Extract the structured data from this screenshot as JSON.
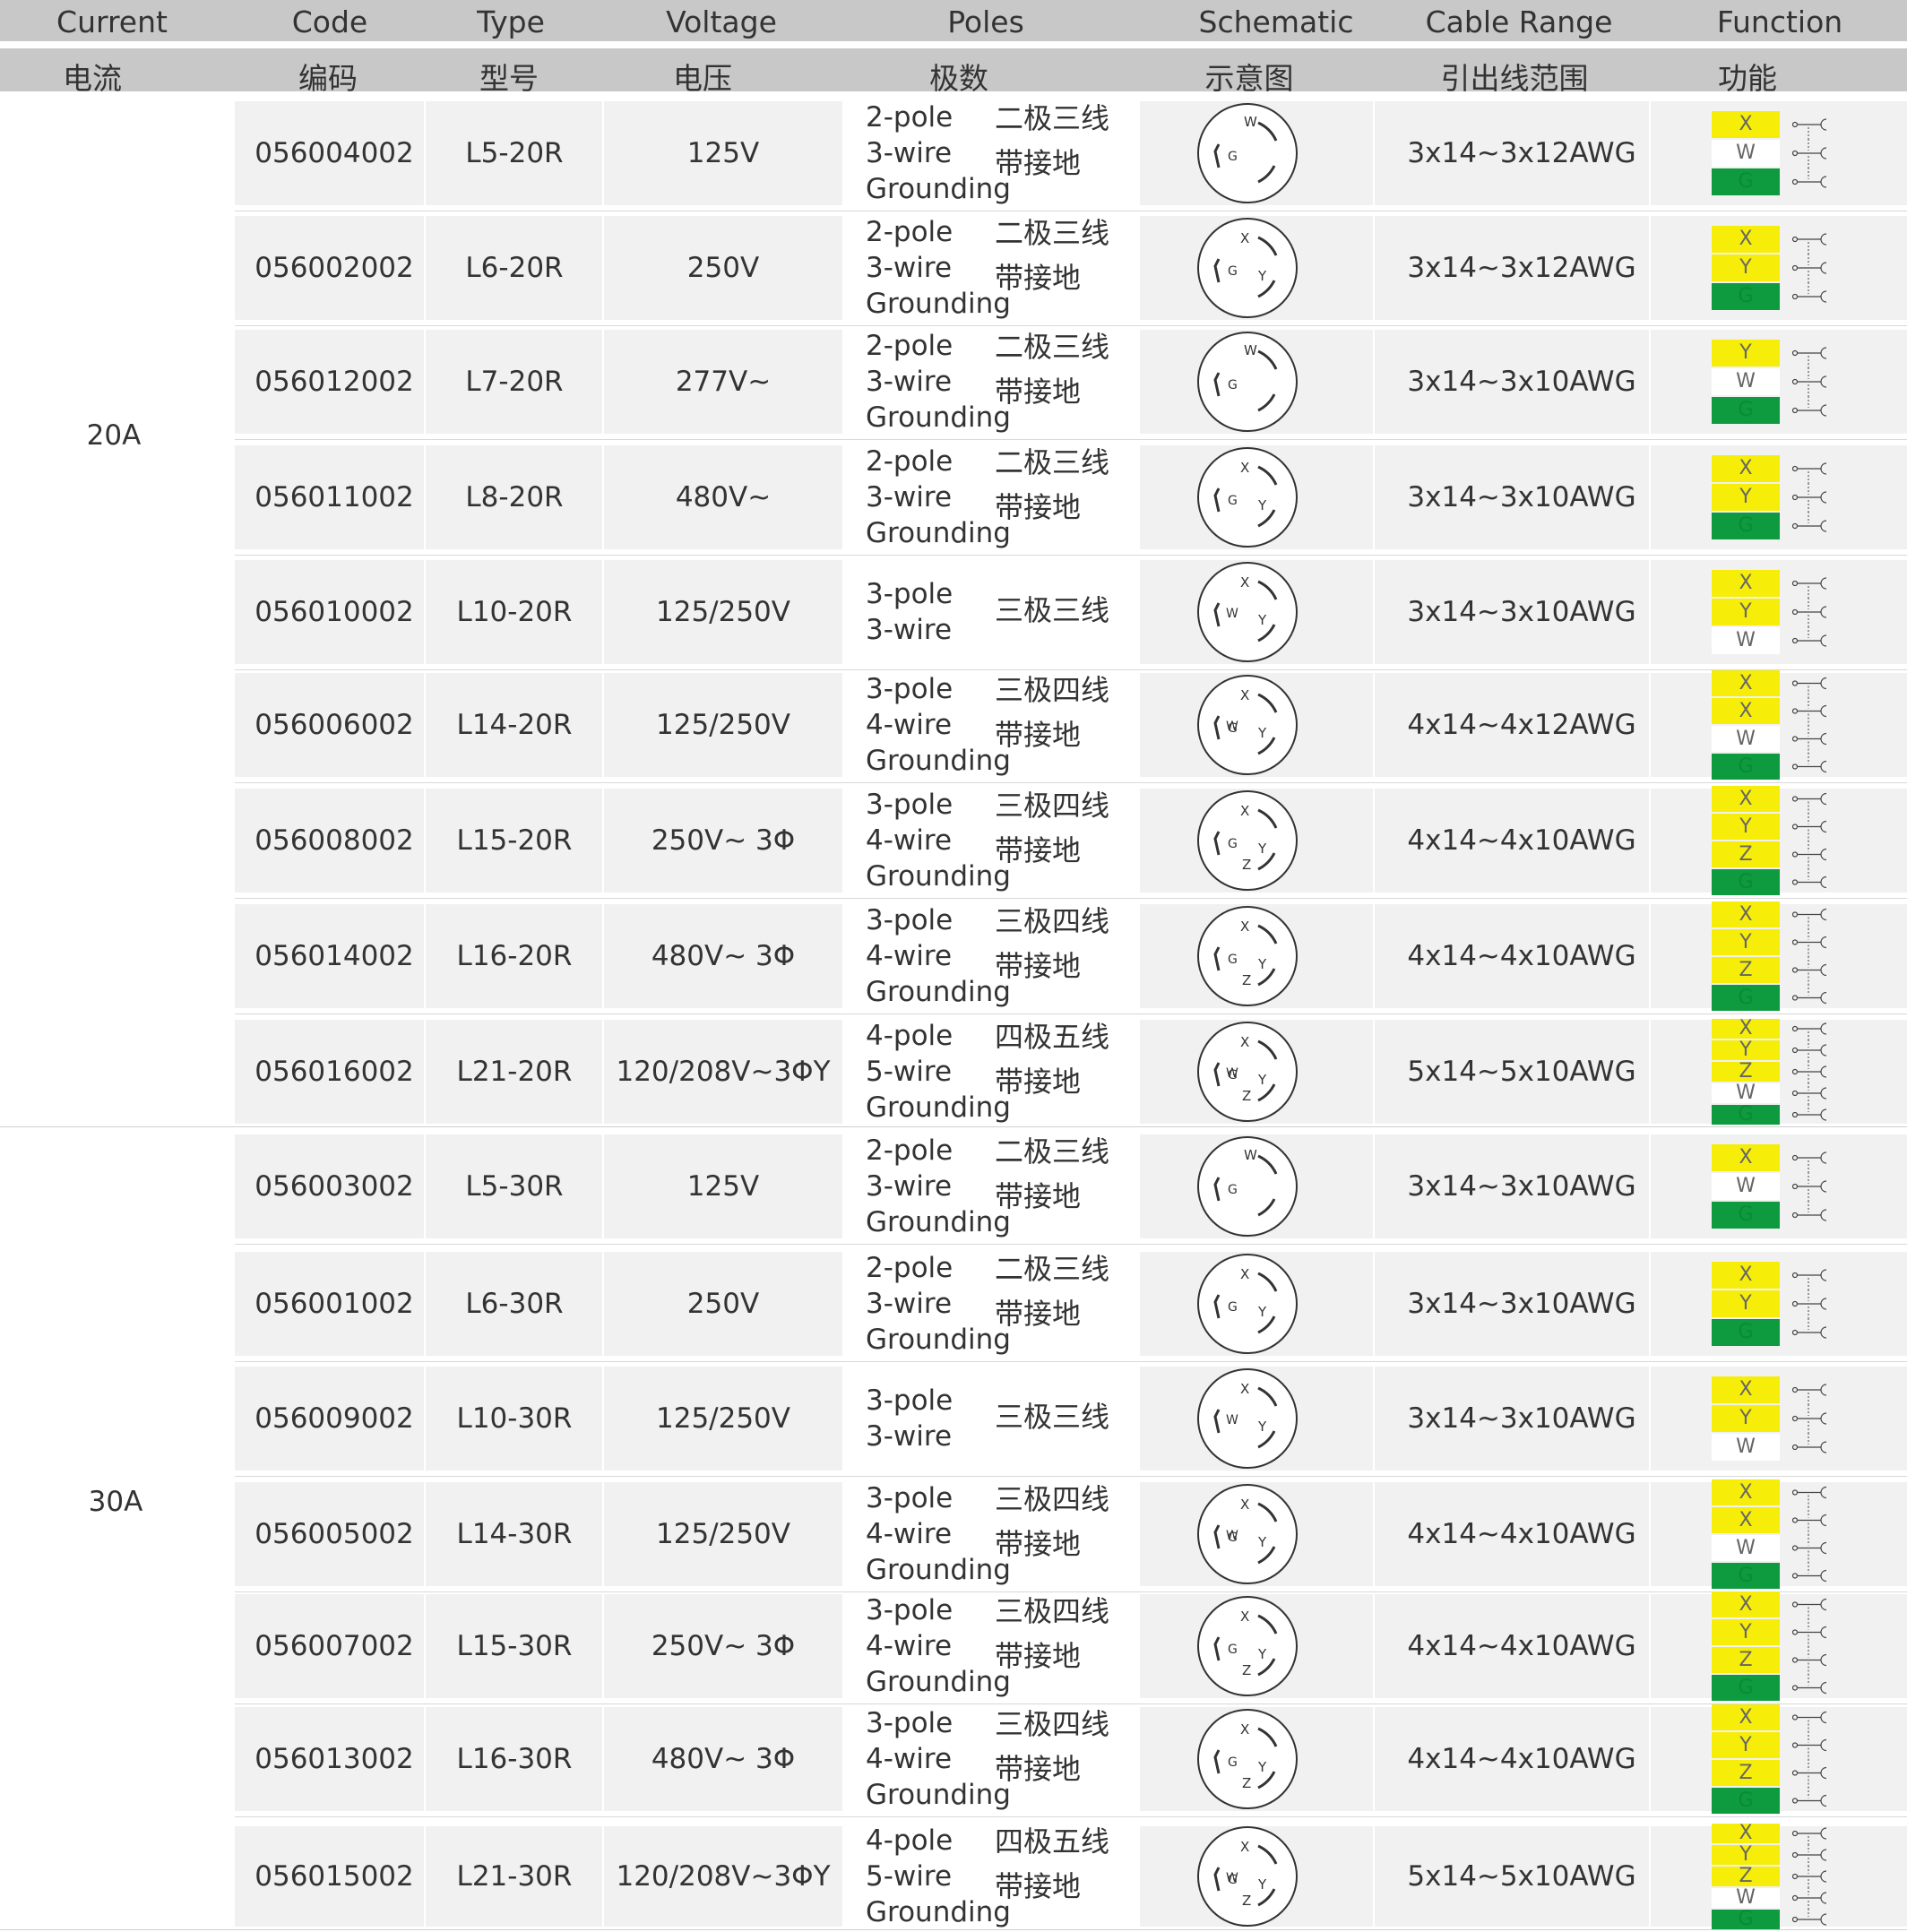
{
  "header": {
    "en": [
      "Current",
      "Code",
      "Type",
      "Voltage",
      "Poles",
      "Schematic",
      "Cable Range",
      "Function"
    ],
    "cn": [
      "电流",
      "编码",
      "型号",
      "电压",
      "极数",
      "示意图",
      "引出线范围",
      "功能"
    ]
  },
  "groups": [
    {
      "current": "20A"
    },
    {
      "current": "30A"
    }
  ],
  "rows": [
    {
      "code": "056004002",
      "type": "L5-20R",
      "voltage": "125V",
      "poles_en": "2-pole\n3-wire\nGrounding",
      "poles_cn": "二极三线\n带接地",
      "schematic": [
        "W",
        "G"
      ],
      "cable": "3x14~3x12AWG",
      "function": [
        {
          "label": "X",
          "color": "yellow"
        },
        {
          "label": "W",
          "color": "white"
        },
        {
          "label": "G",
          "color": "green"
        }
      ]
    },
    {
      "code": "056002002",
      "type": "L6-20R",
      "voltage": "250V",
      "poles_en": "2-pole\n3-wire\nGrounding",
      "poles_cn": "二极三线\n带接地",
      "schematic": [
        "X",
        "G",
        "Y"
      ],
      "cable": "3x14~3x12AWG",
      "function": [
        {
          "label": "X",
          "color": "yellow"
        },
        {
          "label": "Y",
          "color": "yellow"
        },
        {
          "label": "G",
          "color": "green"
        }
      ]
    },
    {
      "code": "056012002",
      "type": "L7-20R",
      "voltage": "277V~",
      "poles_en": "2-pole\n3-wire\nGrounding",
      "poles_cn": "二极三线\n带接地",
      "schematic": [
        "W",
        "G"
      ],
      "cable": "3x14~3x10AWG",
      "function": [
        {
          "label": "Y",
          "color": "yellow"
        },
        {
          "label": "W",
          "color": "white"
        },
        {
          "label": "G",
          "color": "green"
        }
      ]
    },
    {
      "code": "056011002",
      "type": "L8-20R",
      "voltage": "480V~",
      "poles_en": "2-pole\n3-wire\nGrounding",
      "poles_cn": "二极三线\n带接地",
      "schematic": [
        "X",
        "G",
        "Y"
      ],
      "cable": "3x14~3x10AWG",
      "function": [
        {
          "label": "X",
          "color": "yellow"
        },
        {
          "label": "Y",
          "color": "yellow"
        },
        {
          "label": "G",
          "color": "green"
        }
      ]
    },
    {
      "code": "056010002",
      "type": "L10-20R",
      "voltage": "125/250V",
      "poles_en": "3-pole\n3-wire",
      "poles_cn": "三极三线",
      "schematic": [
        "X",
        "W",
        "Y"
      ],
      "cable": "3x14~3x10AWG",
      "function": [
        {
          "label": "X",
          "color": "yellow"
        },
        {
          "label": "Y",
          "color": "yellow"
        },
        {
          "label": "W",
          "color": "white"
        }
      ]
    },
    {
      "code": "056006002",
      "type": "L14-20R",
      "voltage": "125/250V",
      "poles_en": "3-pole\n4-wire\nGrounding",
      "poles_cn": "三极四线\n带接地",
      "schematic": [
        "X",
        "G",
        "W",
        "Y"
      ],
      "cable": "4x14~4x12AWG",
      "function": [
        {
          "label": "X",
          "color": "yellow"
        },
        {
          "label": "X",
          "color": "yellow"
        },
        {
          "label": "W",
          "color": "white"
        },
        {
          "label": "G",
          "color": "green"
        }
      ]
    },
    {
      "code": "056008002",
      "type": "L15-20R",
      "voltage": "250V~ 3Φ",
      "poles_en": "3-pole\n4-wire\nGrounding",
      "poles_cn": "三极四线\n带接地",
      "schematic": [
        "X",
        "G",
        "Y",
        "Z"
      ],
      "cable": "4x14~4x10AWG",
      "function": [
        {
          "label": "X",
          "color": "yellow"
        },
        {
          "label": "Y",
          "color": "yellow"
        },
        {
          "label": "Z",
          "color": "yellow"
        },
        {
          "label": "G",
          "color": "green"
        }
      ]
    },
    {
      "code": "056014002",
      "type": "L16-20R",
      "voltage": "480V~ 3Φ",
      "poles_en": "3-pole\n4-wire\nGrounding",
      "poles_cn": "三极四线\n带接地",
      "schematic": [
        "X",
        "G",
        "Y",
        "Z"
      ],
      "cable": "4x14~4x10AWG",
      "function": [
        {
          "label": "X",
          "color": "yellow"
        },
        {
          "label": "Y",
          "color": "yellow"
        },
        {
          "label": "Z",
          "color": "yellow"
        },
        {
          "label": "G",
          "color": "green"
        }
      ]
    },
    {
      "code": "056016002",
      "type": "L21-20R",
      "voltage": "120/208V~3ΦY",
      "poles_en": "4-pole\n5-wire\nGrounding",
      "poles_cn": "四极五线\n带接地",
      "schematic": [
        "X",
        "W",
        "Y",
        "Z",
        "G"
      ],
      "cable": "5x14~5x10AWG",
      "function": [
        {
          "label": "X",
          "color": "yellow"
        },
        {
          "label": "Y",
          "color": "yellow"
        },
        {
          "label": "Z",
          "color": "yellow"
        },
        {
          "label": "W",
          "color": "white"
        },
        {
          "label": "G",
          "color": "green"
        }
      ]
    },
    {
      "code": "056003002",
      "type": "L5-30R",
      "voltage": "125V",
      "poles_en": "2-pole\n3-wire\nGrounding",
      "poles_cn": "二极三线\n带接地",
      "schematic": [
        "W",
        "G"
      ],
      "cable": "3x14~3x10AWG",
      "function": [
        {
          "label": "X",
          "color": "yellow"
        },
        {
          "label": "W",
          "color": "white"
        },
        {
          "label": "G",
          "color": "green"
        }
      ]
    },
    {
      "code": "056001002",
      "type": "L6-30R",
      "voltage": "250V",
      "poles_en": "2-pole\n3-wire\nGrounding",
      "poles_cn": "二极三线\n带接地",
      "schematic": [
        "X",
        "G",
        "Y"
      ],
      "cable": "3x14~3x10AWG",
      "function": [
        {
          "label": "X",
          "color": "yellow"
        },
        {
          "label": "Y",
          "color": "yellow"
        },
        {
          "label": "G",
          "color": "green"
        }
      ]
    },
    {
      "code": "056009002",
      "type": "L10-30R",
      "voltage": "125/250V",
      "poles_en": "3-pole\n3-wire",
      "poles_cn": "三极三线",
      "schematic": [
        "X",
        "W",
        "Y"
      ],
      "cable": "3x14~3x10AWG",
      "function": [
        {
          "label": "X",
          "color": "yellow"
        },
        {
          "label": "Y",
          "color": "yellow"
        },
        {
          "label": "W",
          "color": "white"
        }
      ]
    },
    {
      "code": "056005002",
      "type": "L14-30R",
      "voltage": "125/250V",
      "poles_en": "3-pole\n4-wire\nGrounding",
      "poles_cn": "三极四线\n带接地",
      "schematic": [
        "X",
        "G",
        "W",
        "Y"
      ],
      "cable": "4x14~4x10AWG",
      "function": [
        {
          "label": "X",
          "color": "yellow"
        },
        {
          "label": "X",
          "color": "yellow"
        },
        {
          "label": "W",
          "color": "white"
        },
        {
          "label": "G",
          "color": "green"
        }
      ]
    },
    {
      "code": "056007002",
      "type": "L15-30R",
      "voltage": "250V~ 3Φ",
      "poles_en": "3-pole\n4-wire\nGrounding",
      "poles_cn": "三极四线\n带接地",
      "schematic": [
        "X",
        "G",
        "Y",
        "Z"
      ],
      "cable": "4x14~4x10AWG",
      "function": [
        {
          "label": "X",
          "color": "yellow"
        },
        {
          "label": "Y",
          "color": "yellow"
        },
        {
          "label": "Z",
          "color": "yellow"
        },
        {
          "label": "G",
          "color": "green"
        }
      ]
    },
    {
      "code": "056013002",
      "type": "L16-30R",
      "voltage": "480V~ 3Φ",
      "poles_en": "3-pole\n4-wire\nGrounding",
      "poles_cn": "三极四线\n带接地",
      "schematic": [
        "X",
        "G",
        "Y",
        "Z"
      ],
      "cable": "4x14~4x10AWG",
      "function": [
        {
          "label": "X",
          "color": "yellow"
        },
        {
          "label": "Y",
          "color": "yellow"
        },
        {
          "label": "Z",
          "color": "yellow"
        },
        {
          "label": "G",
          "color": "green"
        }
      ]
    },
    {
      "code": "056015002",
      "type": "L21-30R",
      "voltage": "120/208V~3ΦY",
      "poles_en": "4-pole\n5-wire\nGrounding",
      "poles_cn": "四极五线\n带接地",
      "schematic": [
        "X",
        "W",
        "Y",
        "Z",
        "G"
      ],
      "cable": "5x14~5x10AWG",
      "function": [
        {
          "label": "X",
          "color": "yellow"
        },
        {
          "label": "Y",
          "color": "yellow"
        },
        {
          "label": "Z",
          "color": "yellow"
        },
        {
          "label": "W",
          "color": "white"
        },
        {
          "label": "G",
          "color": "green"
        }
      ]
    }
  ],
  "colors": {
    "header_bg": "#c8c8c8",
    "cell_bg": "#f1f1f1",
    "yellow": "#f6ee08",
    "green": "#0e9a3e",
    "line": "#d8d8d8"
  }
}
